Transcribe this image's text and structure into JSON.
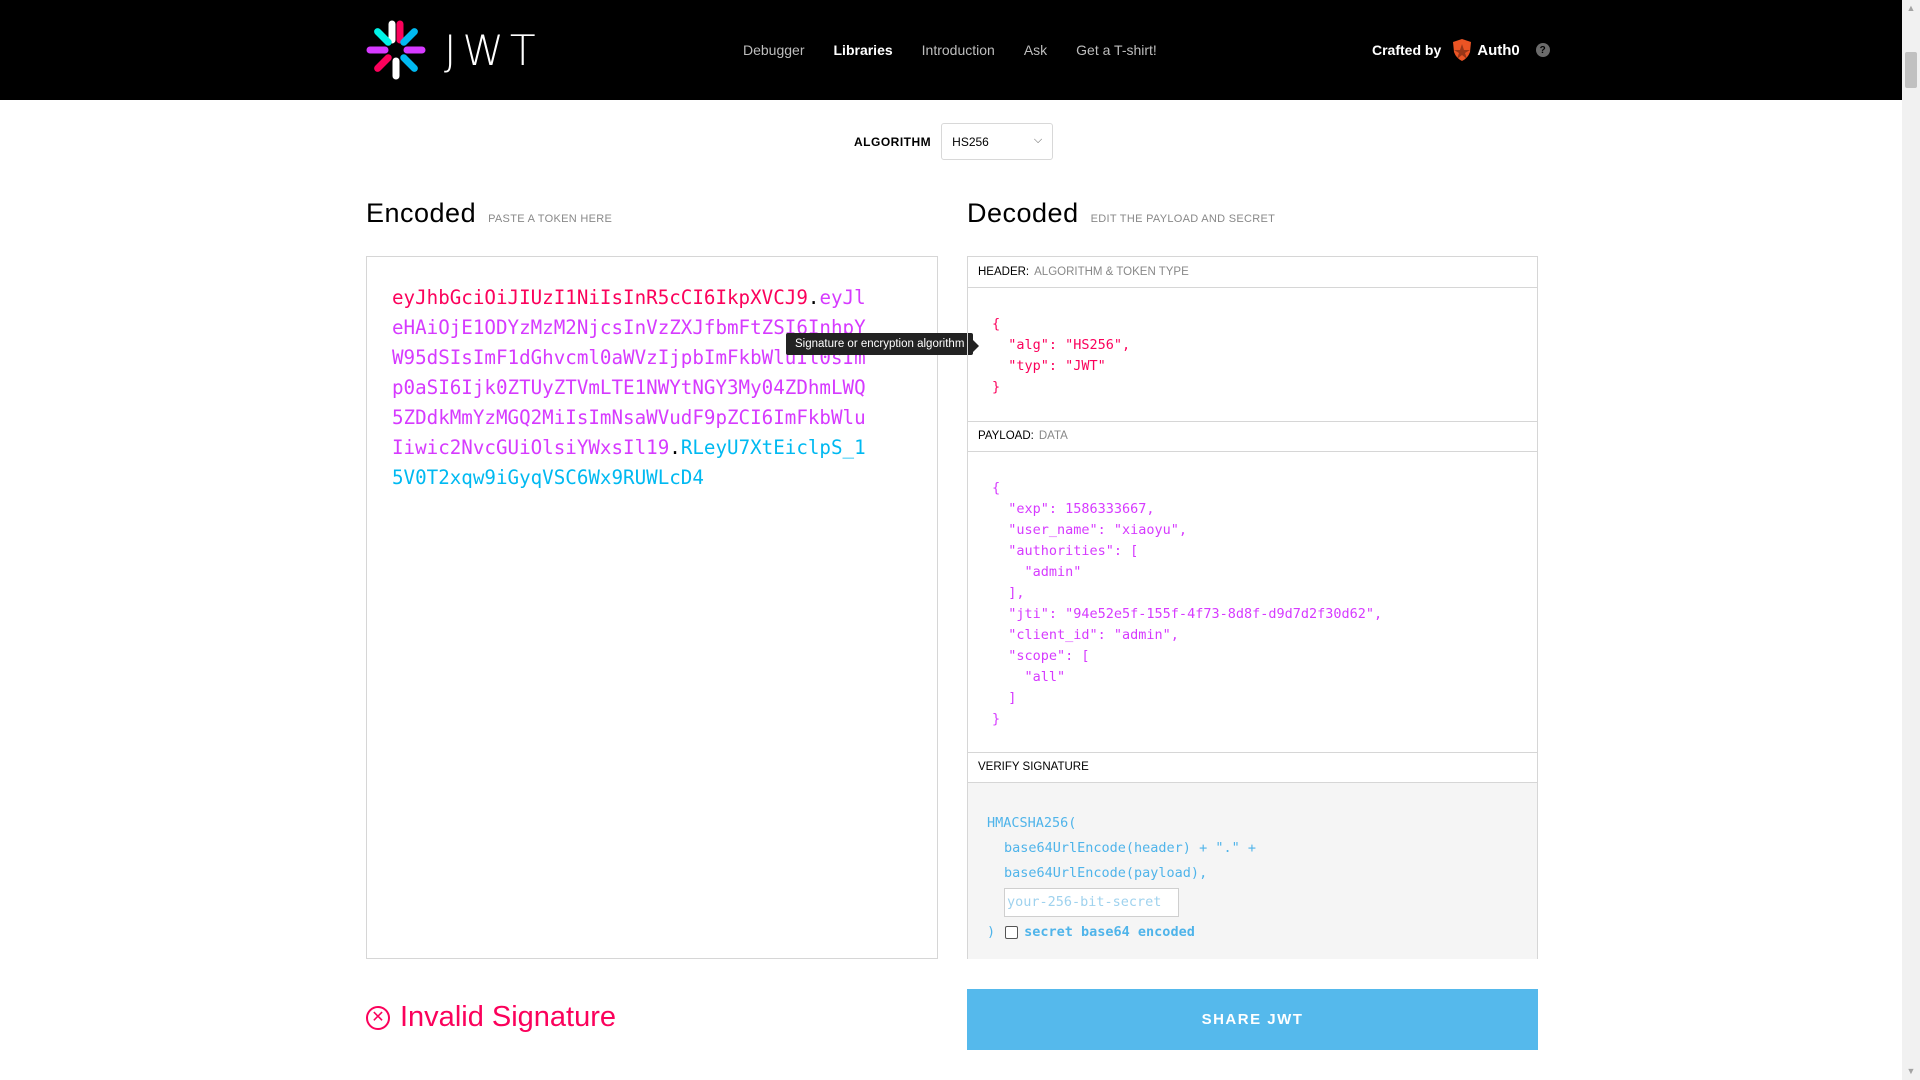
{
  "header": {
    "logo_word": "JWT",
    "nav": [
      "Debugger",
      "Libraries",
      "Introduction",
      "Ask",
      "Get a T-shirt!"
    ],
    "active_nav": "Libraries",
    "crafted_label": "Crafted by",
    "crafted_brand": "Auth0",
    "help": "?"
  },
  "algorithm": {
    "label": "ALGORITHM",
    "value": "HS256"
  },
  "encoded": {
    "title": "Encoded",
    "subtitle": "PASTE A TOKEN HERE",
    "token_header": "eyJhbGciOiJIUzI1NiIsInR5cCI6IkpXVCJ9",
    "token_payload": "eyJleHAiOjE1ODYzMzM2NjcsInVzZXJfbmFtZSI6InhpYW95dSIsImF1dGhvcml0aWVzIjpbImFkbWluIl0sImp0aSI6Ijk0ZTUyZTVmLTE1NWYtNGY3My04ZDhmLWQ5ZDdkMmYzMGQ2MiIsImNsaWVudF9pZCI6ImFkbWluIiwic2NvcGUiOlsiYWxsIl19",
    "token_signature": "RLeyU7XtEiclpS_15V0T2xqw9iGyqVSC6Wx9RUWLcD4",
    "dot": "."
  },
  "tooltip": "Signature or encryption algorithm",
  "decoded": {
    "title": "Decoded",
    "subtitle": "EDIT THE PAYLOAD AND SECRET",
    "header_label": "HEADER:",
    "header_sub": "ALGORITHM & TOKEN TYPE",
    "header_json": "{\n  \"alg\": \"HS256\",\n  \"typ\": \"JWT\"\n}",
    "payload_label": "PAYLOAD:",
    "payload_sub": "DATA",
    "payload_json": "{\n  \"exp\": 1586333667,\n  \"user_name\": \"xiaoyu\",\n  \"authorities\": [\n    \"admin\"\n  ],\n  \"jti\": \"94e52e5f-155f-4f73-8d8f-d9d7d2f30d62\",\n  \"client_id\": \"admin\",\n  \"scope\": [\n    \"all\"\n  ]\n}",
    "verify_label": "VERIFY SIGNATURE",
    "verify_fn": "HMACSHA256(",
    "verify_line1": "base64UrlEncode(header) + \".\" +",
    "verify_line2": "base64UrlEncode(payload),",
    "secret_placeholder": "your-256-bit-secret",
    "verify_close": ")",
    "b64_label": "secret base64 encoded"
  },
  "status": {
    "invalid_text": "Invalid Signature",
    "color": "#fb015b"
  },
  "share_label": "SHARE JWT",
  "colors": {
    "header_part": "#fb015b",
    "payload_part": "#d63aff",
    "signature_part": "#00b9f1",
    "share_button": "#55b9ec"
  }
}
